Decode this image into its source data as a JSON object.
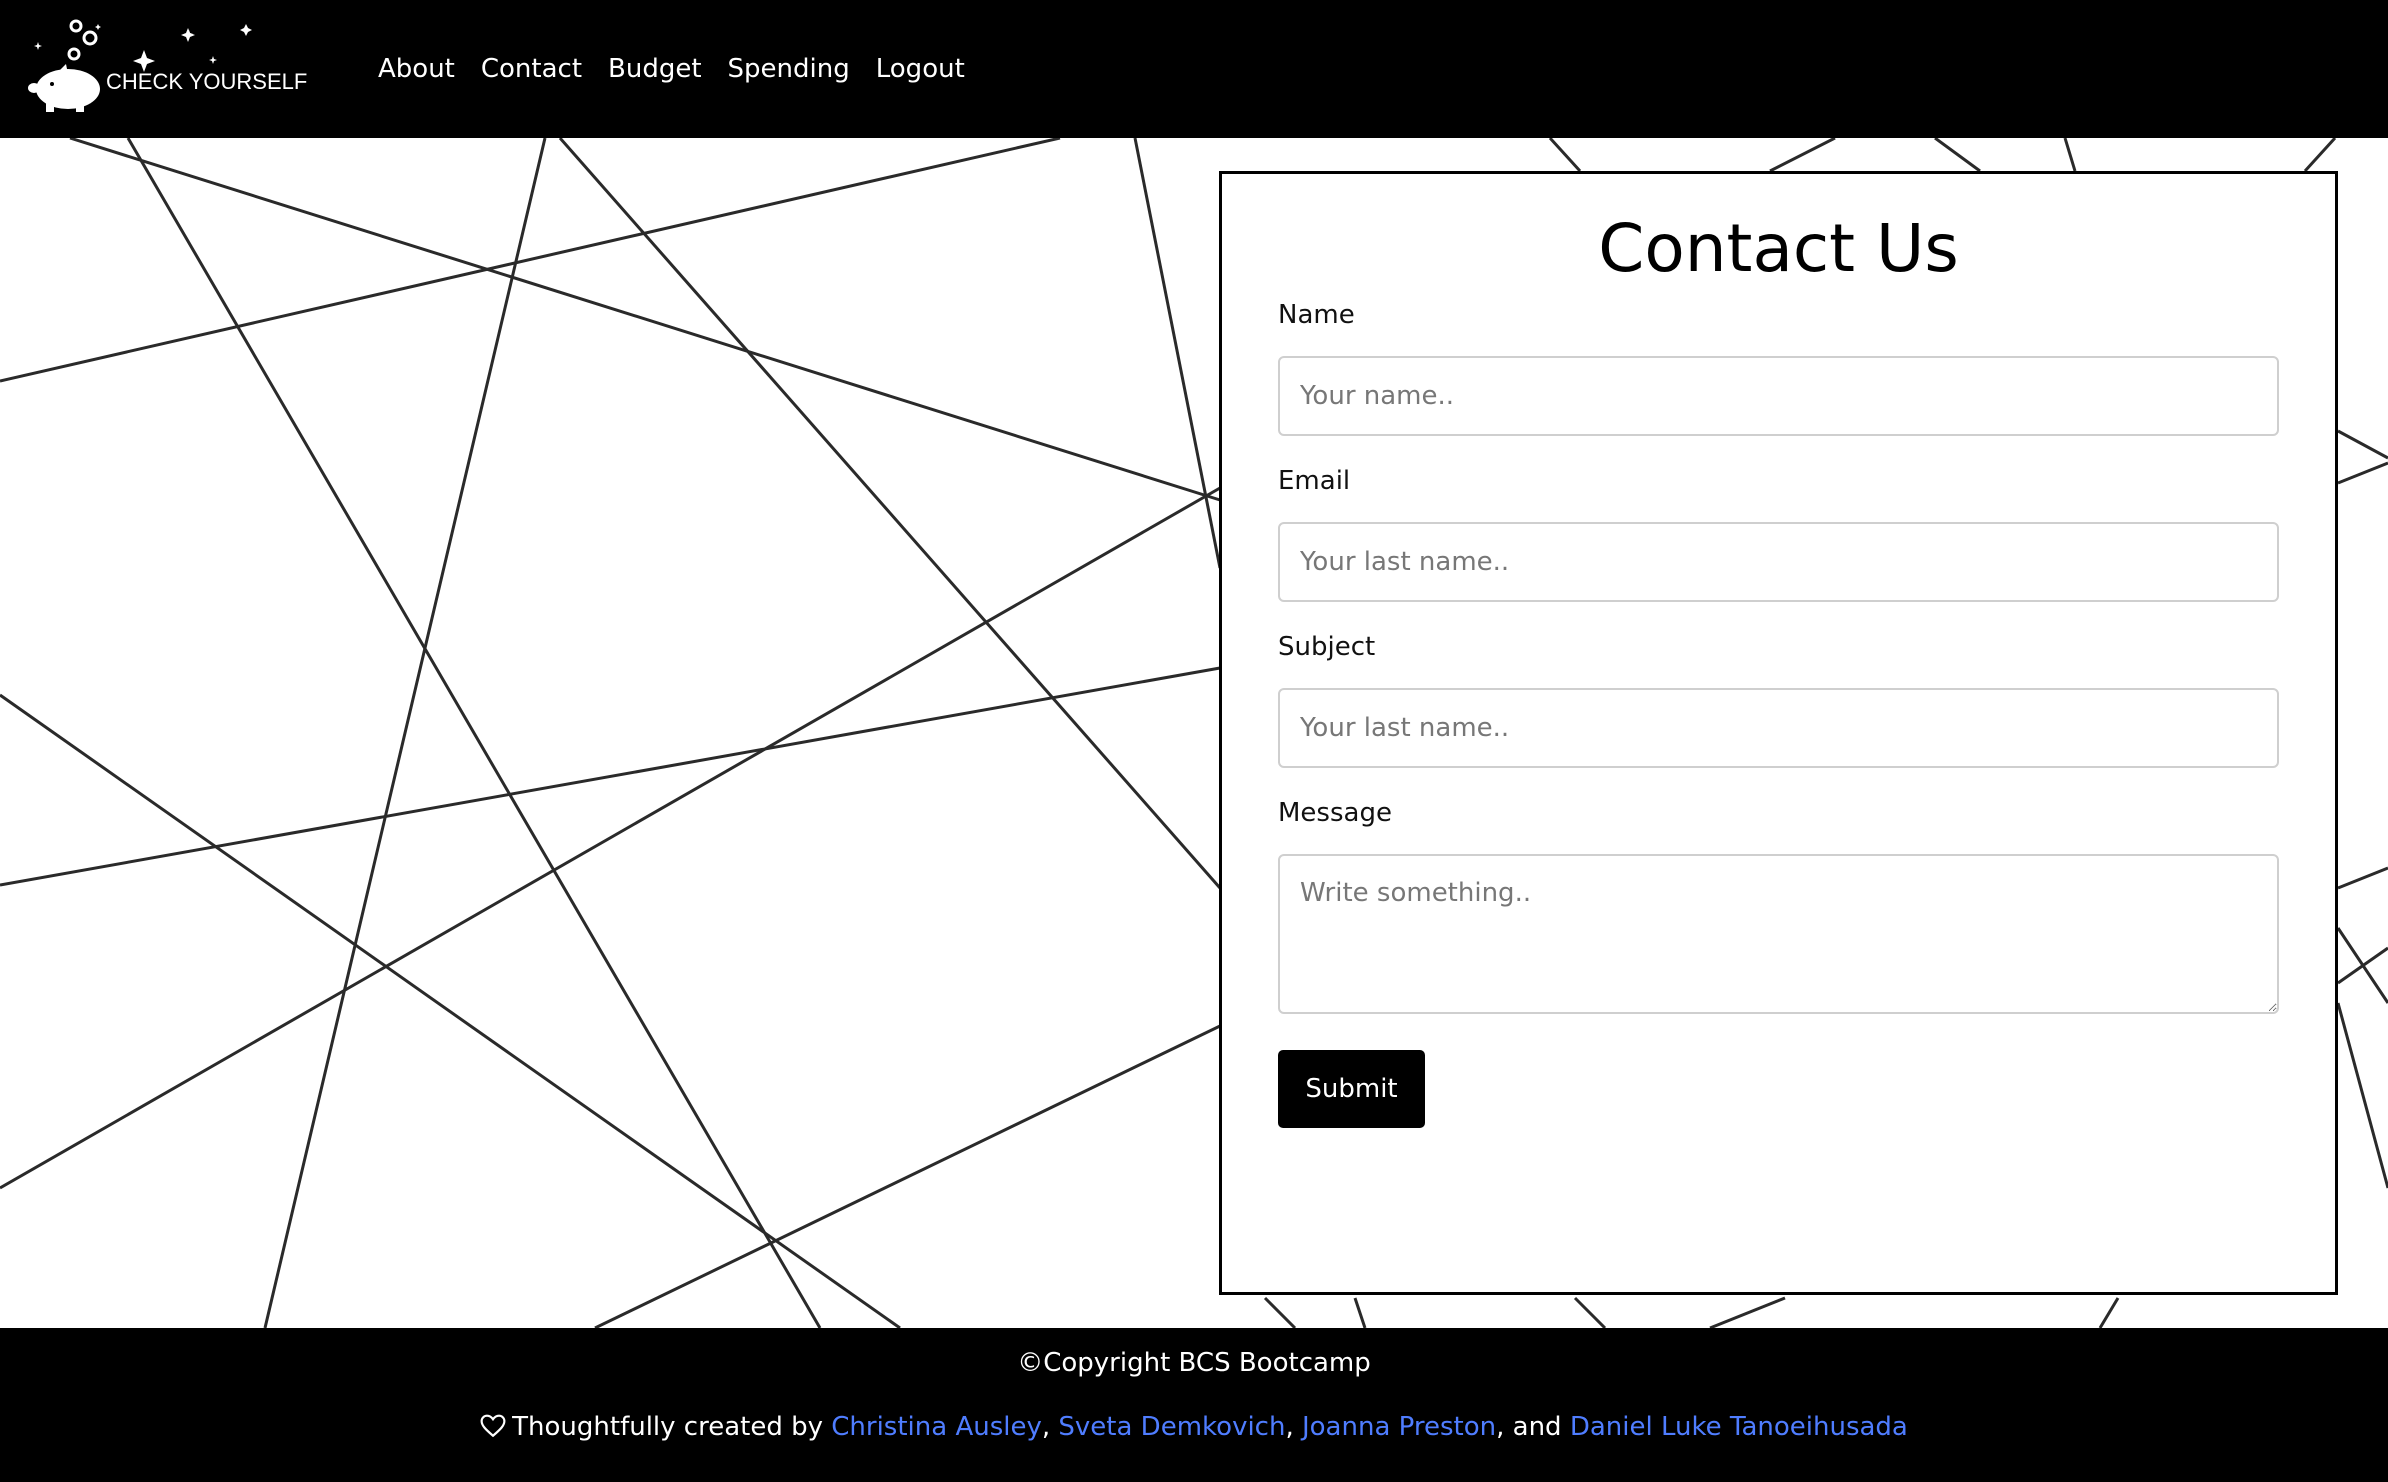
{
  "brand": {
    "name": "CHECK YOURSELF"
  },
  "nav": {
    "links": [
      {
        "label": "About"
      },
      {
        "label": "Contact"
      },
      {
        "label": "Budget"
      },
      {
        "label": "Spending"
      },
      {
        "label": "Logout"
      }
    ]
  },
  "form": {
    "title": "Contact Us",
    "fields": {
      "name": {
        "label": "Name",
        "placeholder": "Your name.."
      },
      "email": {
        "label": "Email",
        "placeholder": "Your last name.."
      },
      "subject": {
        "label": "Subject",
        "placeholder": "Your last name.."
      },
      "message": {
        "label": "Message",
        "placeholder": "Write something.."
      }
    },
    "submit_label": "Submit"
  },
  "footer": {
    "copyright_symbol": "©",
    "copyright": "Copyright BCS Bootcamp",
    "credits_prefix": "Thoughtfully created by",
    "authors": [
      "Christina Ausley",
      "Sveta Demkovich",
      "Joanna Preston",
      "Daniel Luke Tanoeihusada"
    ],
    "separator": ",",
    "and": ", and"
  },
  "colors": {
    "nav_bg": "#000000",
    "link_blue": "#4f7dff",
    "card_border": "#000000",
    "line_color": "#2a2a2a"
  },
  "icons": {
    "heart": "heart-outline-icon",
    "piggy": "piggy-bank-icon"
  }
}
